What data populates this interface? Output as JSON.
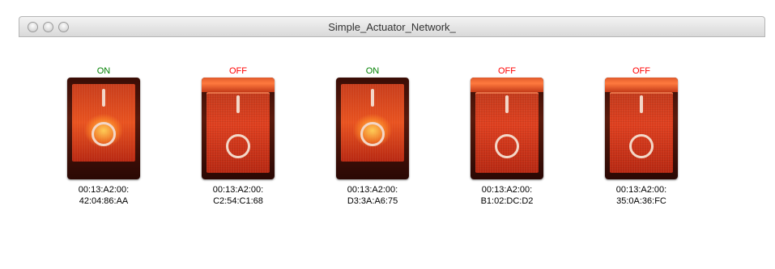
{
  "window": {
    "title": "Simple_Actuator_Network_"
  },
  "switches": [
    {
      "state": "ON",
      "mac_line1": "00:13:A2:00:",
      "mac_line2": "42:04:86:AA"
    },
    {
      "state": "OFF",
      "mac_line1": "00:13:A2:00:",
      "mac_line2": "C2:54:C1:68"
    },
    {
      "state": "ON",
      "mac_line1": "00:13:A2:00:",
      "mac_line2": "D3:3A:A6:75"
    },
    {
      "state": "OFF",
      "mac_line1": "00:13:A2:00:",
      "mac_line2": "B1:02:DC:D2"
    },
    {
      "state": "OFF",
      "mac_line1": "00:13:A2:00:",
      "mac_line2": "35:0A:36:FC"
    }
  ],
  "colors": {
    "on": "#008000",
    "off": "#ff0000",
    "switch_red": "#e0401f"
  },
  "icons": {
    "window_buttons": [
      "close-icon",
      "minimize-icon",
      "zoom-icon"
    ]
  }
}
